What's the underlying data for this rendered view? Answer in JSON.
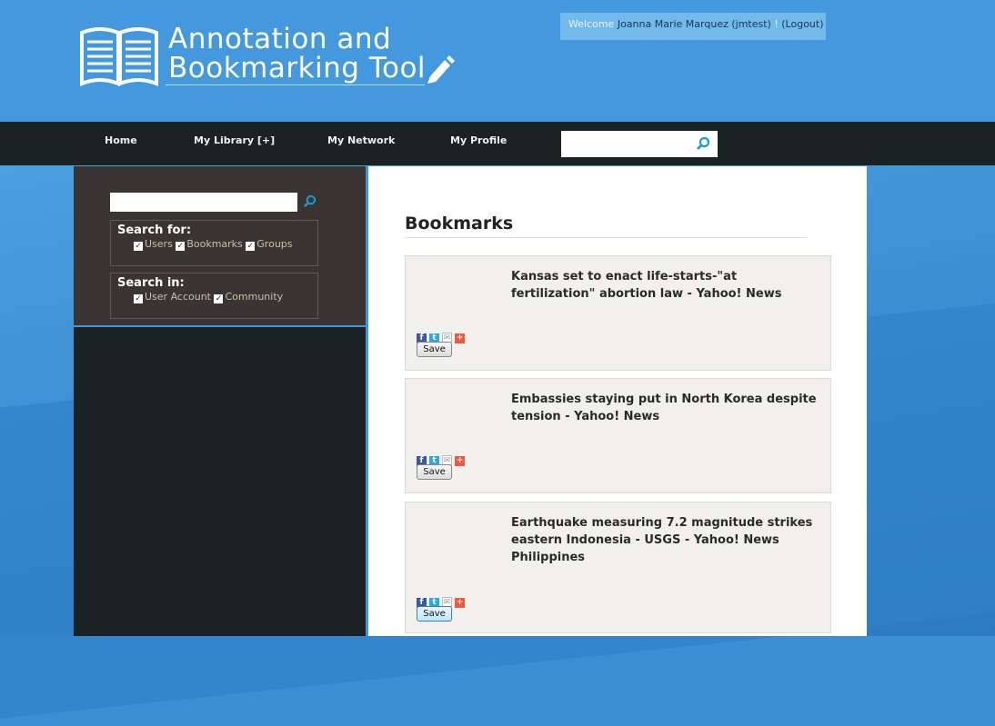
{
  "header": {
    "logo_line1": "Annotation and",
    "logo_line2": "Bookmarking Tool",
    "welcome_label": "Welcome",
    "user_name": "Joanna Marie Marquez (jmtest)",
    "separator": "!",
    "logout": "(Logout)"
  },
  "nav": {
    "items": [
      "Home",
      "My Library [+]",
      "My Network",
      "My Profile"
    ],
    "search_value": ""
  },
  "sidebar": {
    "search_value": "",
    "search_for_title": "Search for:",
    "search_for_options": [
      "Users",
      "Bookmarks",
      "Groups"
    ],
    "search_in_title": "Search in:",
    "search_in_options": [
      "User Account",
      "Community"
    ]
  },
  "main": {
    "heading": "Bookmarks",
    "bookmarks": [
      {
        "title": "Kansas set to enact life-starts-\"at fertilization\" abortion law - Yahoo! News",
        "save": "Save"
      },
      {
        "title": "Embassies staying put in North Korea despite tension - Yahoo! News",
        "save": "Save"
      },
      {
        "title": "Earthquake measuring 7.2 magnitude strikes eastern Indonesia - USGS - Yahoo! News Philippines",
        "save": "Save"
      }
    ]
  },
  "colors": {
    "header_bg": "#4499de",
    "nav_bg": "#1a2224",
    "sidebar_top_bg": "#3a3532",
    "accent": "#3f98de",
    "card_bg": "#f2f0ec"
  },
  "icons": [
    "book-logo-icon",
    "pencil-icon",
    "search-icon",
    "facebook-icon",
    "twitter-icon",
    "email-icon",
    "addthis-plus-icon",
    "checkbox-checked-icon"
  ]
}
